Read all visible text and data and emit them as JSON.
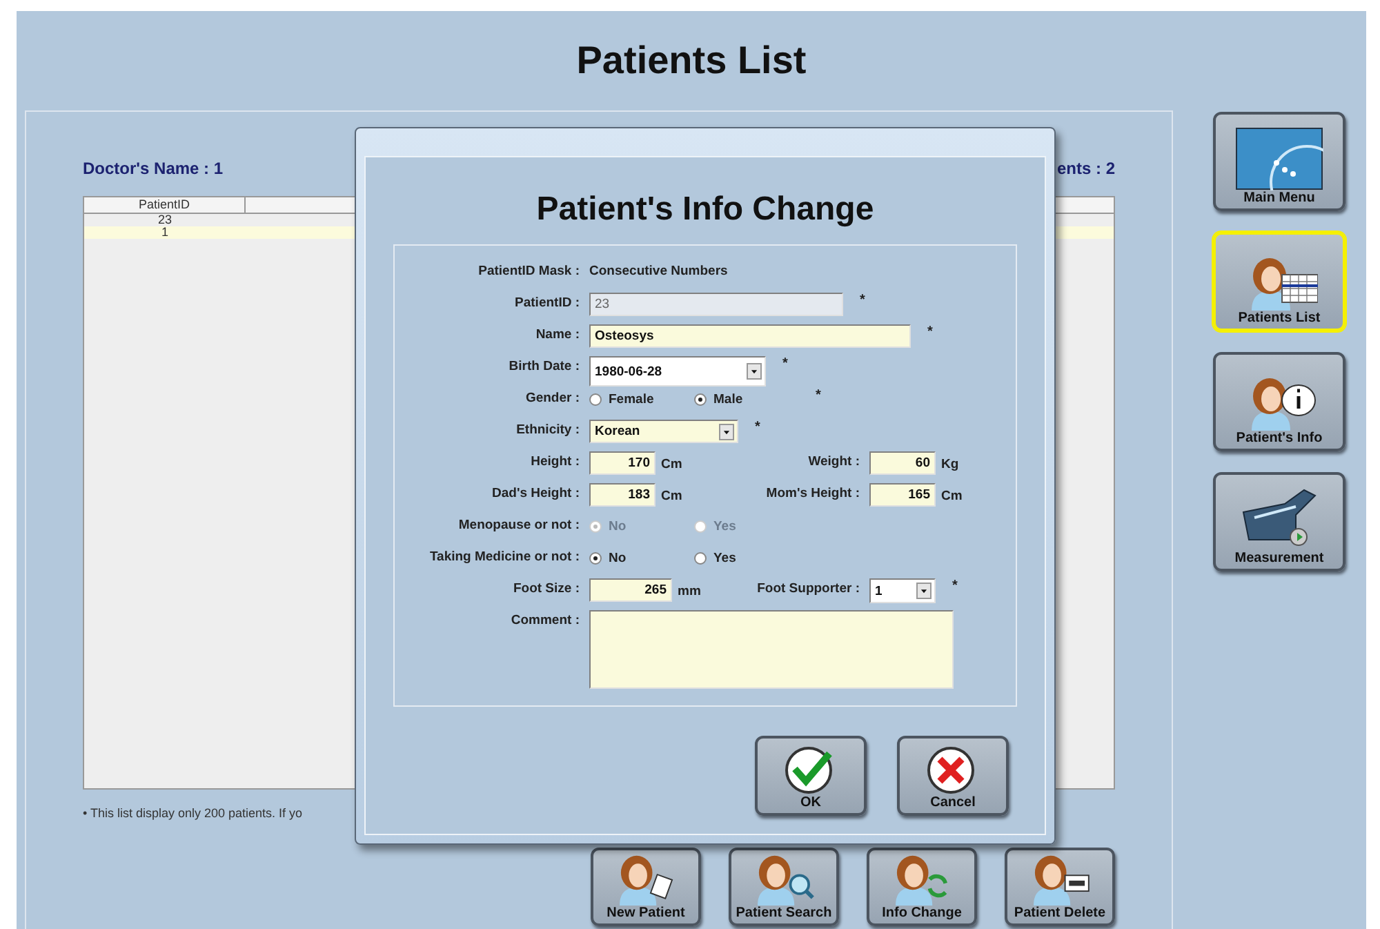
{
  "title": "Patients List",
  "panel": {
    "doctor": "Doctor's Name : 1",
    "patients_count": "ents : 2",
    "table": {
      "columns": [
        "PatientID"
      ],
      "rows": [
        {
          "cells": [
            "23"
          ],
          "selected": false
        },
        {
          "cells": [
            "1"
          ],
          "selected": true
        }
      ]
    },
    "note": "• This list display only 200 patients. If yo"
  },
  "bottom_buttons": [
    {
      "label": "New Patient",
      "kind": "new"
    },
    {
      "label": "Patient Search",
      "kind": "search"
    },
    {
      "label": "Info Change",
      "kind": "change"
    },
    {
      "label": "Patient Delete",
      "kind": "delete"
    }
  ],
  "sidebar": [
    {
      "label": "Main Menu",
      "kind": "menu",
      "selected": false
    },
    {
      "label": "Patients List",
      "kind": "list",
      "selected": true
    },
    {
      "label": "Patient's Info",
      "kind": "info",
      "selected": false
    },
    {
      "label": "Measurement",
      "kind": "measure",
      "selected": false
    }
  ],
  "dialog": {
    "title": "Patient's Info Change",
    "rows": [
      {
        "kind": "static",
        "label": "PatientID Mask :",
        "value": "Consecutive Numbers"
      },
      {
        "kind": "short-input",
        "label": "PatientID :",
        "value": "23",
        "disabled": true,
        "required_mark": "*"
      },
      {
        "kind": "long-input",
        "label": "Name :",
        "value": "Osteosys",
        "disabled": false,
        "required_mark": "*"
      },
      {
        "kind": "date-select",
        "label": "Birth Date :",
        "value": "1980-06-28",
        "required_mark": "*"
      },
      {
        "kind": "radio",
        "label": "Gender :",
        "disabled": false,
        "required_mark": "*",
        "options": [
          {
            "label": "Female",
            "selected": false
          },
          {
            "label": "Male",
            "selected": true
          }
        ]
      },
      {
        "kind": "list-select",
        "label": "Ethnicity :",
        "value": "Korean",
        "required_mark": "*"
      },
      {
        "kind": "pair",
        "label": "Height :",
        "value": "170",
        "unit": "Cm",
        "right": {
          "label": "Weight :",
          "kind": "input",
          "value": "60",
          "unit": "Kg"
        }
      },
      {
        "kind": "pair",
        "label": "Dad's Height :",
        "value": "183",
        "unit": "Cm",
        "right": {
          "label": "Mom's Height :",
          "kind": "input",
          "value": "165",
          "unit": "Cm"
        }
      },
      {
        "kind": "radio",
        "label": "Menopause or not :",
        "disabled": true,
        "options": [
          {
            "label": "No",
            "selected": true
          },
          {
            "label": "Yes",
            "selected": false
          }
        ]
      },
      {
        "kind": "radio",
        "label": "Taking Medicine or not :",
        "disabled": false,
        "options": [
          {
            "label": "No",
            "selected": true
          },
          {
            "label": "Yes",
            "selected": false
          }
        ]
      },
      {
        "kind": "pair",
        "label": "Foot Size :",
        "value": "265",
        "unit": "mm",
        "right": {
          "label": "Foot Supporter :",
          "kind": "select",
          "value": "1",
          "required_mark": "*"
        }
      },
      {
        "kind": "textarea",
        "label": "Comment :"
      }
    ],
    "buttons": [
      {
        "label": "OK",
        "kind": "ok"
      },
      {
        "label": "Cancel",
        "kind": "cancel"
      }
    ]
  }
}
